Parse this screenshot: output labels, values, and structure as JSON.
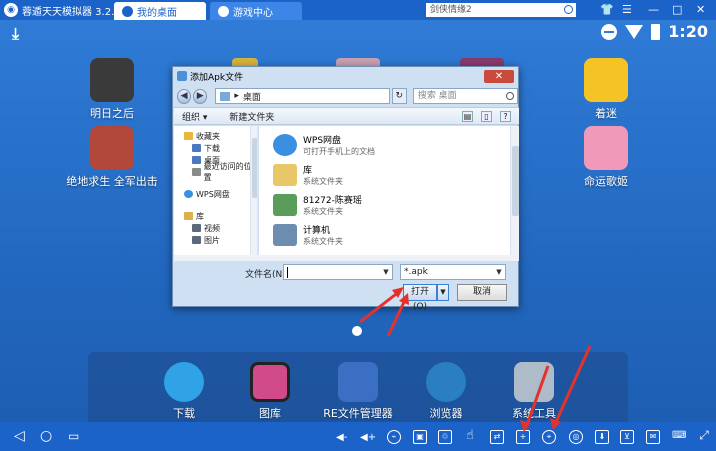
{
  "emulator": {
    "title": "蓉遁天天模拟器 3.2.2",
    "tabs": [
      {
        "label": "我的桌面"
      },
      {
        "label": "游戏中心"
      }
    ],
    "search_value": "剑侠情缘2"
  },
  "status": {
    "time": "1:20"
  },
  "desktop_apps": [
    {
      "label": "明日之后",
      "color": "#3a3a3a"
    },
    {
      "label": "绝地求生 全军出击",
      "color": "#b2473b"
    },
    {
      "label": "着迷",
      "color": "#f6c324"
    },
    {
      "label": "命运歌姬",
      "color": "#f199b8"
    }
  ],
  "dock_apps": [
    {
      "label": "下载",
      "color": "#2fa3e6"
    },
    {
      "label": "图库",
      "color": "#d14a8a"
    },
    {
      "label": "RE文件管理器",
      "color": "#3b6fc4"
    },
    {
      "label": "浏览器",
      "color": "#2a7fc0"
    },
    {
      "label": "系统工具",
      "color": "#aebbc9"
    }
  ],
  "dialog": {
    "title": "添加Apk文件",
    "close_symbol": "✕",
    "address": "桌面",
    "search_placeholder": "搜索 桌面",
    "toolbar": {
      "organize": "组织 ▾",
      "new_folder": "新建文件夹"
    },
    "nav_items": [
      {
        "label": "收藏夹",
        "color": "#e7b73a"
      },
      {
        "label": "下载",
        "color": "#4a79c0"
      },
      {
        "label": "桌面",
        "color": "#4a79c0"
      },
      {
        "label": "最近访问的位置",
        "color": "#8a8a8a"
      },
      {
        "label": "WPS网盘",
        "color": "#3a8fe0"
      },
      {
        "label": "库",
        "color": "#d9b14a"
      },
      {
        "label": "视频",
        "color": "#5a6a7a"
      },
      {
        "label": "图片",
        "color": "#5a6a7a"
      }
    ],
    "files": [
      {
        "name": "WPS网盘",
        "sub": "可打开手机上的文档",
        "color": "#3a8fe0"
      },
      {
        "name": "库",
        "sub": "系统文件夹",
        "color": "#e8c766"
      },
      {
        "name": "81272-陈赛瑶",
        "sub": "系统文件夹",
        "color": "#5a9d5a"
      },
      {
        "name": "计算机",
        "sub": "系统文件夹",
        "color": "#6c8cb0"
      }
    ],
    "filename_label": "文件名(N):",
    "filename_value": "",
    "filter": "*.apk",
    "open_label": "打开(O)",
    "cancel_label": "取消"
  },
  "accent_colors": {
    "emulator_blue": "#1c63c9",
    "annotation_red": "#e5312b"
  }
}
